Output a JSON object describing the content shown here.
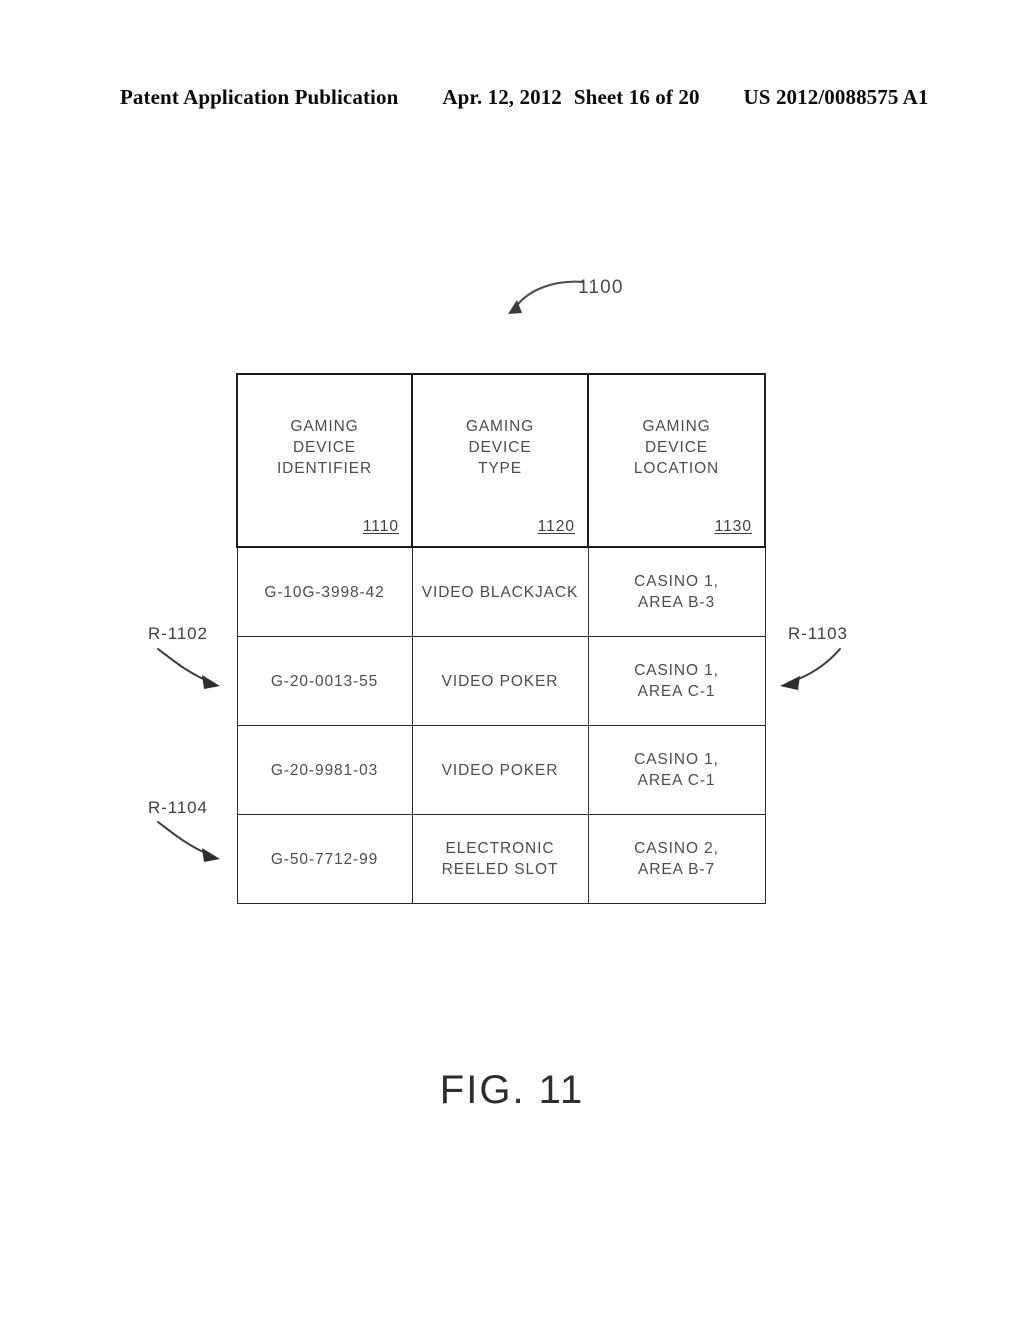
{
  "page_header": {
    "publication": "Patent Application Publication",
    "date": "Apr. 12, 2012",
    "sheet": "Sheet 16 of 20",
    "patent_number": "US 2012/0088575 A1"
  },
  "figure": {
    "caption": "FIG. 11",
    "table_reference": "1100"
  },
  "table": {
    "columns": [
      {
        "title": "GAMING\nDEVICE\nIDENTIFIER",
        "line1": "GAMING",
        "line2": "DEVICE",
        "line3": "IDENTIFIER",
        "ref": "1110"
      },
      {
        "title": "GAMING\nDEVICE\nTYPE",
        "line1": "GAMING",
        "line2": "DEVICE",
        "line3": "TYPE",
        "ref": "1120"
      },
      {
        "title": "GAMING\nDEVICE\nLOCATION",
        "line1": "GAMING",
        "line2": "DEVICE",
        "line3": "LOCATION",
        "ref": "1130"
      }
    ],
    "rows": [
      {
        "identifier": "G-10G-3998-42",
        "type_line1": "VIDEO BLACKJACK",
        "type_line2": "",
        "location_line1": "CASINO 1,",
        "location_line2": "AREA B-3"
      },
      {
        "identifier": "G-20-0013-55",
        "type_line1": "VIDEO POKER",
        "type_line2": "",
        "location_line1": "CASINO 1,",
        "location_line2": "AREA C-1"
      },
      {
        "identifier": "G-20-9981-03",
        "type_line1": "VIDEO POKER",
        "type_line2": "",
        "location_line1": "CASINO 1,",
        "location_line2": "AREA C-1"
      },
      {
        "identifier": "G-50-7712-99",
        "type_line1": "ELECTRONIC",
        "type_line2": "REELED SLOT",
        "location_line1": "CASINO 2,",
        "location_line2": "AREA B-7"
      }
    ]
  },
  "callouts": {
    "left_upper": "R-1102",
    "left_lower": "R-1104",
    "right": "R-1103"
  }
}
